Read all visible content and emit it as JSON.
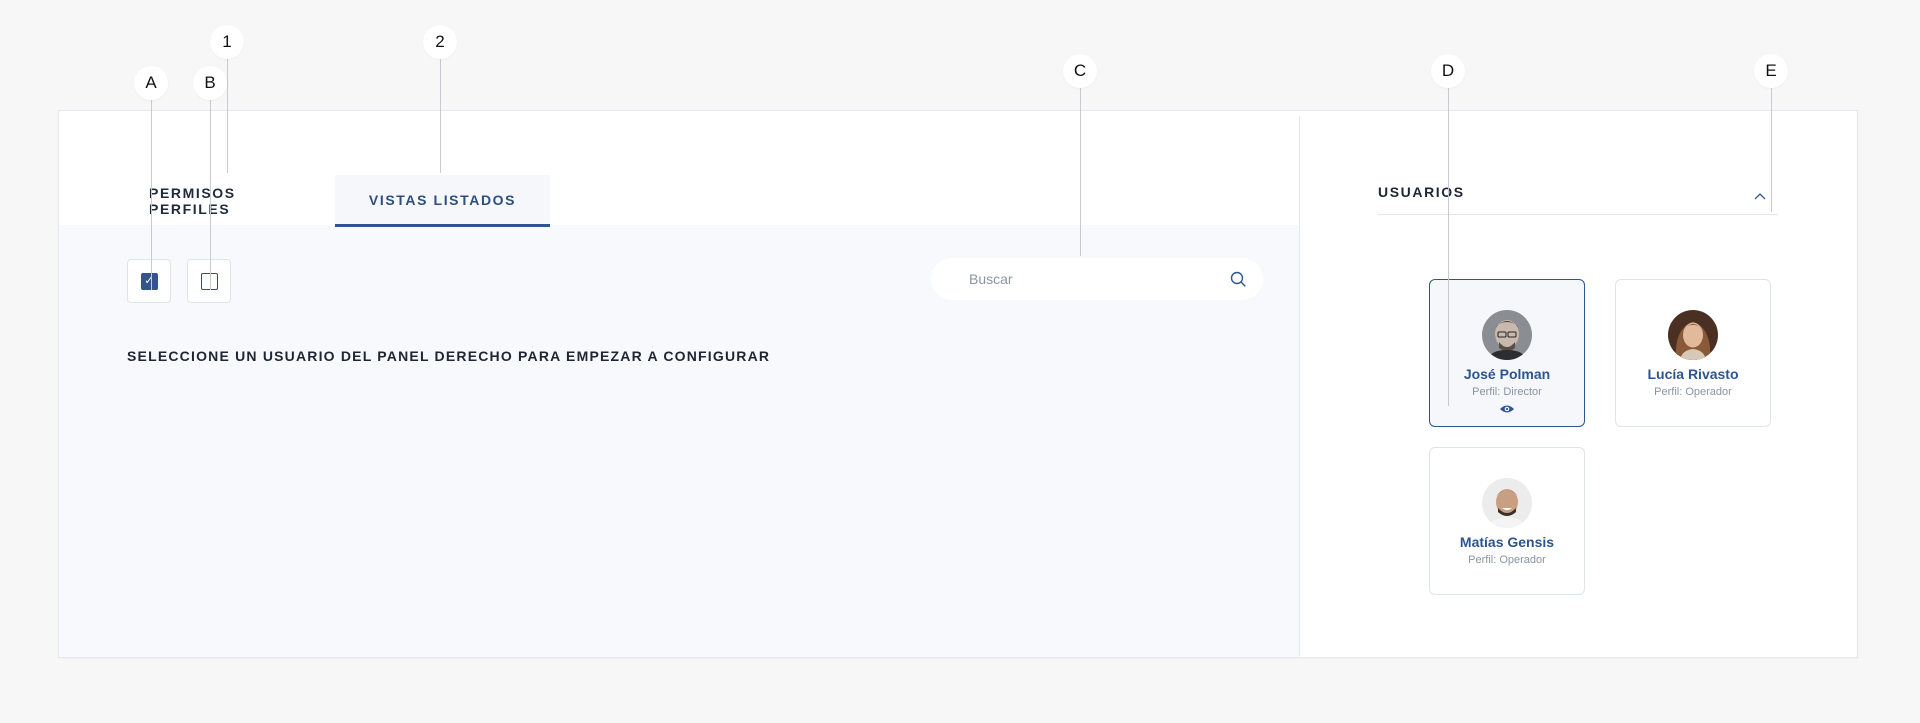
{
  "tabs": [
    {
      "label": "PERMISOS PERFILES",
      "active": false
    },
    {
      "label": "VISTAS LISTADOS",
      "active": true
    }
  ],
  "checkboxes": [
    {
      "checked": true
    },
    {
      "checked": false
    }
  ],
  "search": {
    "placeholder": "Buscar",
    "value": ""
  },
  "instruction": "SELECCIONE UN USUARIO DEL PANEL DERECHO PARA EMPEZAR A CONFIGURAR",
  "users_panel": {
    "title": "USUARIOS",
    "users": [
      {
        "name": "José Polman",
        "role": "Perfil: Director",
        "selected": true
      },
      {
        "name": "Lucía Rivasto",
        "role": "Perfil: Operador",
        "selected": false
      },
      {
        "name": "Matías Gensis",
        "role": "Perfil: Operador",
        "selected": false
      }
    ]
  },
  "annotations": [
    "1",
    "2",
    "A",
    "B",
    "C",
    "D",
    "E"
  ],
  "colors": {
    "accent": "#2d5590",
    "background": "#f7f7f7",
    "panel": "#f8f9fc"
  },
  "icons": {
    "search": "search-icon",
    "collapse": "chevron-up-icon",
    "view": "eye-icon"
  }
}
